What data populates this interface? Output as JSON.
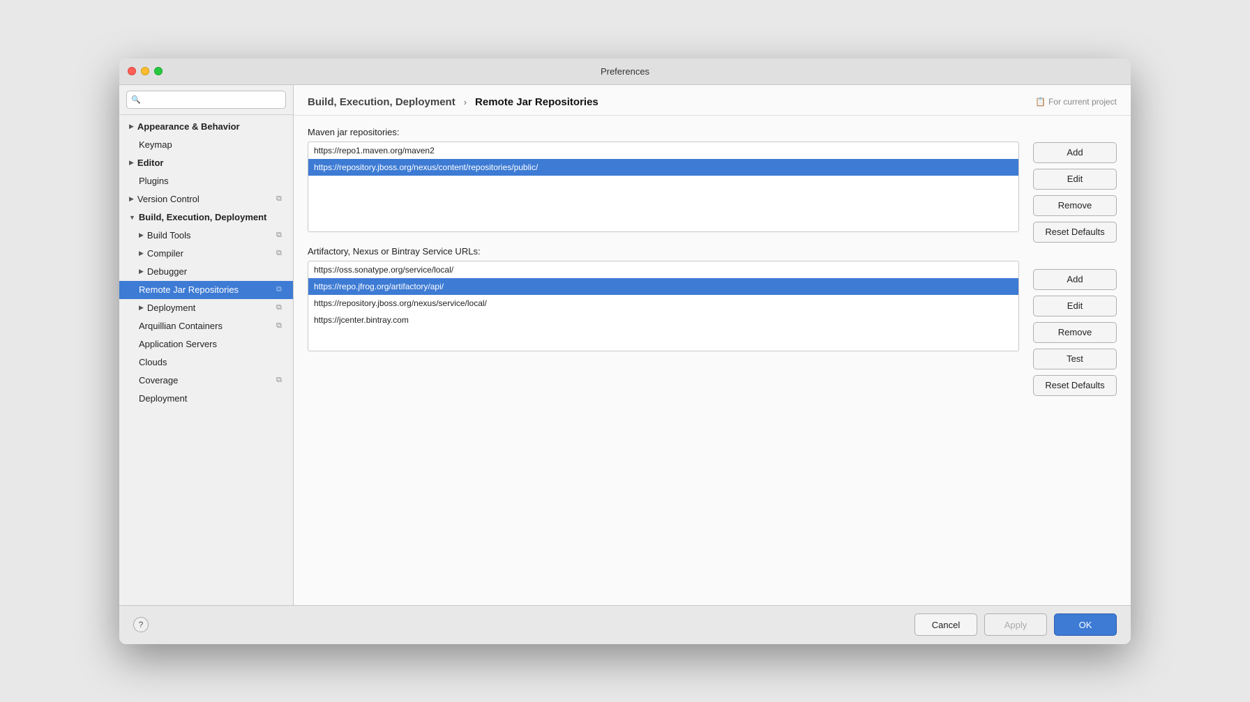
{
  "window": {
    "title": "Preferences"
  },
  "sidebar": {
    "search_placeholder": "🔍",
    "items": [
      {
        "id": "appearance",
        "label": "Appearance & Behavior",
        "level": 0,
        "chevron": "▶",
        "bold": true,
        "copy": false,
        "active": false
      },
      {
        "id": "keymap",
        "label": "Keymap",
        "level": 0,
        "chevron": "",
        "bold": false,
        "copy": false,
        "active": false
      },
      {
        "id": "editor",
        "label": "Editor",
        "level": 0,
        "chevron": "▶",
        "bold": true,
        "copy": false,
        "active": false
      },
      {
        "id": "plugins",
        "label": "Plugins",
        "level": 0,
        "chevron": "",
        "bold": false,
        "copy": false,
        "active": false
      },
      {
        "id": "version-control",
        "label": "Version Control",
        "level": 0,
        "chevron": "▶",
        "bold": false,
        "copy": true,
        "active": false
      },
      {
        "id": "build-execution",
        "label": "Build, Execution, Deployment",
        "level": 0,
        "chevron": "▼",
        "bold": true,
        "copy": false,
        "active": false
      },
      {
        "id": "build-tools",
        "label": "Build Tools",
        "level": 1,
        "chevron": "▶",
        "bold": false,
        "copy": true,
        "active": false
      },
      {
        "id": "compiler",
        "label": "Compiler",
        "level": 1,
        "chevron": "▶",
        "bold": false,
        "copy": true,
        "active": false
      },
      {
        "id": "debugger",
        "label": "Debugger",
        "level": 1,
        "chevron": "▶",
        "bold": false,
        "copy": false,
        "active": false
      },
      {
        "id": "remote-jar",
        "label": "Remote Jar Repositories",
        "level": 1,
        "chevron": "",
        "bold": false,
        "copy": true,
        "active": true
      },
      {
        "id": "deployment",
        "label": "Deployment",
        "level": 1,
        "chevron": "▶",
        "bold": false,
        "copy": true,
        "active": false
      },
      {
        "id": "arquillian",
        "label": "Arquillian Containers",
        "level": 0,
        "chevron": "",
        "bold": false,
        "copy": true,
        "active": false
      },
      {
        "id": "app-servers",
        "label": "Application Servers",
        "level": 0,
        "chevron": "",
        "bold": false,
        "copy": false,
        "active": false
      },
      {
        "id": "clouds",
        "label": "Clouds",
        "level": 0,
        "chevron": "",
        "bold": false,
        "copy": false,
        "active": false
      },
      {
        "id": "coverage",
        "label": "Coverage",
        "level": 0,
        "chevron": "",
        "bold": false,
        "copy": true,
        "active": false
      },
      {
        "id": "deployment2",
        "label": "Deployment",
        "level": 0,
        "chevron": "",
        "bold": false,
        "copy": false,
        "active": false
      }
    ]
  },
  "header": {
    "breadcrumb_parent": "Build, Execution, Deployment",
    "breadcrumb_arrow": "›",
    "breadcrumb_current": "Remote Jar Repositories",
    "for_project_icon": "📋",
    "for_project_label": "For current project"
  },
  "maven_section": {
    "label": "Maven jar repositories:",
    "items": [
      {
        "url": "https://repo1.maven.org/maven2",
        "selected": false
      },
      {
        "url": "https://repository.jboss.org/nexus/content/repositories/public/",
        "selected": true
      }
    ],
    "buttons": {
      "add": "Add",
      "edit": "Edit",
      "remove": "Remove",
      "reset": "Reset Defaults"
    }
  },
  "artifactory_section": {
    "label": "Artifactory, Nexus or Bintray Service URLs:",
    "items": [
      {
        "url": "https://oss.sonatype.org/service/local/",
        "selected": false
      },
      {
        "url": "https://repo.jfrog.org/artifactory/api/",
        "selected": true
      },
      {
        "url": "https://repository.jboss.org/nexus/service/local/",
        "selected": false
      },
      {
        "url": "https://jcenter.bintray.com",
        "selected": false
      }
    ],
    "buttons": {
      "add": "Add",
      "edit": "Edit",
      "remove": "Remove",
      "test": "Test",
      "reset": "Reset Defaults"
    }
  },
  "bottom": {
    "help_label": "?",
    "cancel_label": "Cancel",
    "apply_label": "Apply",
    "ok_label": "OK"
  }
}
